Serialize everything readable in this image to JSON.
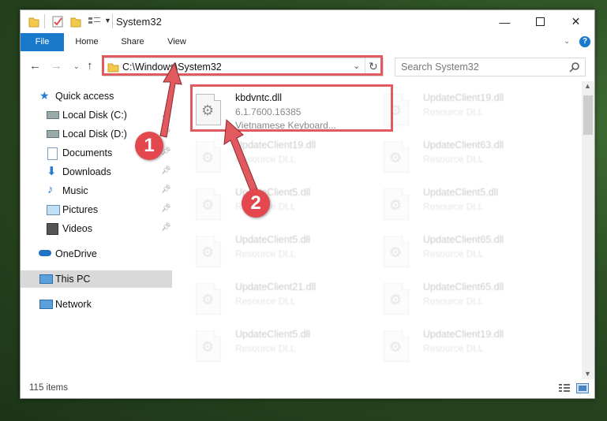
{
  "window": {
    "title": "System32"
  },
  "ribbon": {
    "tabs": [
      "File",
      "Home",
      "Share",
      "View"
    ]
  },
  "address": {
    "path": "C:\\Windows\\System32",
    "search_placeholder": "Search System32"
  },
  "nav": {
    "items": [
      {
        "label": "Quick access",
        "icon": "star-icon"
      },
      {
        "label": "Local Disk (C:)",
        "icon": "drive-icon",
        "pinned": true
      },
      {
        "label": "Local Disk (D:)",
        "icon": "drive-icon",
        "pinned": true
      },
      {
        "label": "Documents",
        "icon": "documents-icon",
        "pinned": true
      },
      {
        "label": "Downloads",
        "icon": "downloads-icon",
        "pinned": true
      },
      {
        "label": "Music",
        "icon": "music-icon",
        "pinned": true
      },
      {
        "label": "Pictures",
        "icon": "pictures-icon",
        "pinned": true
      },
      {
        "label": "Videos",
        "icon": "videos-icon",
        "pinned": true
      },
      {
        "label": "OneDrive",
        "icon": "onedrive-icon"
      },
      {
        "label": "This PC",
        "icon": "pc-icon",
        "selected": true
      },
      {
        "label": "Network",
        "icon": "network-icon"
      }
    ]
  },
  "files": [
    {
      "name": "kbdvntc.dll",
      "line2": "6.1.7600.16385",
      "line3": "Vietnamese Keyboard..."
    },
    {
      "name": "UpdateClient19.dll",
      "line2": "Resource DLL"
    },
    {
      "name": "UpdateClient19.dll",
      "line2": "Resource DLL"
    },
    {
      "name": "UpdateClient63.dll",
      "line2": "Resource DLL"
    },
    {
      "name": "UpdateClient5.dll",
      "line2": "Resource DLL"
    },
    {
      "name": "UpdateClient5.dll",
      "line2": "Resource DLL"
    },
    {
      "name": "UpdateClient5.dll",
      "line2": "Resource DLL"
    },
    {
      "name": "UpdateClient65.dll",
      "line2": "Resource DLL"
    },
    {
      "name": "UpdateClient21.dll",
      "line2": "Resource DLL"
    },
    {
      "name": "UpdateClient65.dll",
      "line2": "Resource DLL"
    },
    {
      "name": "UpdateClient5.dll",
      "line2": "Resource DLL"
    },
    {
      "name": "UpdateClient19.dll",
      "line2": "Resource DLL"
    }
  ],
  "status": {
    "count": "115 items"
  },
  "annotations": {
    "step1": "1",
    "step2": "2",
    "color": "#e05a5f"
  }
}
